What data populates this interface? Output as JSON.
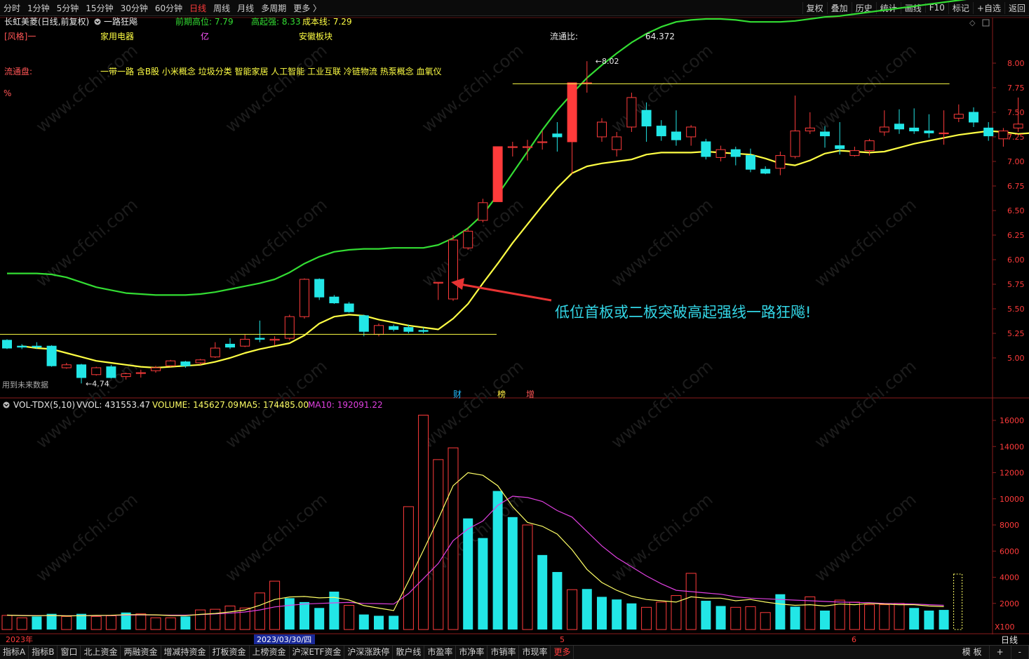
{
  "toolbar": {
    "periods": [
      "分时",
      "1分钟",
      "5分钟",
      "15分钟",
      "30分钟",
      "60分钟",
      "日线",
      "周线",
      "月线",
      "多周期",
      "更多 〉"
    ],
    "active_period": "日线",
    "right_buttons": [
      "复权",
      "叠加",
      "历史",
      "统计",
      "画线",
      "F10",
      "标记",
      "+自选",
      "返回"
    ]
  },
  "header": {
    "stock": "长虹美菱(日线,前复权)",
    "formula": "一路狂飚",
    "labels": [
      {
        "text": "前期高位: 7.79",
        "color": "#33dd33"
      },
      {
        "text": "高起强: 8.33",
        "color": "#33dd33"
      },
      {
        "text": "成本线: 7.29",
        "color": "#ffff44"
      }
    ],
    "style_tag": "[风格]一",
    "industry": "家用电器",
    "yi": "亿",
    "region": "安徽板块",
    "float_label": "流通比:",
    "float_value": "64.372",
    "liutong": "流通盘:",
    "pct": "%",
    "concepts": "一带一路 含B股 小米概念 垃圾分类 智能家居 人工智能 工业互联 冷链物流 热泵概念 血氧仪",
    "future_note": "用到未来数据"
  },
  "annotation": {
    "text": "低位首板或二板突破高起强线一路狂飚!",
    "color": "#33d6e6"
  },
  "markers": [
    "财",
    "榜",
    "增"
  ],
  "vol_header": {
    "name": "VOL-TDX(5,10)",
    "vvol": "VVOL: 431553.47",
    "volume": "VOLUME: 145627.09",
    "ma5": "MA5: 174485.00",
    "ma10": "MA10: 192091.22"
  },
  "date_axis": {
    "year": "2023年",
    "highlight": "2023/03/30/四",
    "m5": "5",
    "m6": "6",
    "right": "日线"
  },
  "vol_unit": "X100",
  "bottom_tabs": [
    "指标A",
    "指标B",
    "窗口",
    "北上资金",
    "两融资金",
    "增减持资金",
    "打板资金",
    "上榜资金",
    "沪深ETF资金",
    "沪深涨跌停",
    "散户线",
    "市盈率",
    "市净率",
    "市销率",
    "市现率",
    "更多"
  ],
  "bottom_right": [
    "模 板",
    "+",
    "-"
  ],
  "colors": {
    "up": "#ff3b3b",
    "down": "#22e6e6",
    "high_line": "#33dd33",
    "cost_line": "#ffff44",
    "ma5": "#ffff66",
    "ma10": "#e040e0"
  },
  "chart_data": [
    {
      "type": "candlestick",
      "title": "长虹美菱(日线,前复权)",
      "ylim": [
        4.6,
        8.3
      ],
      "y_ticks": [
        5.0,
        5.25,
        5.5,
        5.75,
        6.0,
        6.25,
        6.5,
        6.75,
        7.0,
        7.25,
        7.5,
        7.75,
        8.0
      ],
      "annotations": [
        {
          "label": "8.02",
          "value": 8.02
        },
        {
          "label": "4.74",
          "value": 4.74
        }
      ],
      "reference_lines": [
        {
          "value": 7.79
        },
        {
          "value": 5.24
        }
      ],
      "candles": [
        [
          5.18,
          5.1,
          5.19,
          5.09
        ],
        [
          5.12,
          5.11,
          5.14,
          5.09
        ],
        [
          5.12,
          5.11,
          5.16,
          5.09
        ],
        [
          5.12,
          4.92,
          5.13,
          4.91
        ],
        [
          4.9,
          4.93,
          4.95,
          4.89
        ],
        [
          4.93,
          4.8,
          4.94,
          4.74
        ],
        [
          4.83,
          4.9,
          4.91,
          4.82
        ],
        [
          4.91,
          4.8,
          4.93,
          4.79
        ],
        [
          4.81,
          4.84,
          4.85,
          4.78
        ],
        [
          4.85,
          4.85,
          4.88,
          4.8
        ],
        [
          4.87,
          4.9,
          4.92,
          4.85
        ],
        [
          4.92,
          4.97,
          4.98,
          4.91
        ],
        [
          4.96,
          4.92,
          4.97,
          4.9
        ],
        [
          4.95,
          4.98,
          4.99,
          4.93
        ],
        [
          5.01,
          5.1,
          5.16,
          5.0
        ],
        [
          5.14,
          5.11,
          5.2,
          5.09
        ],
        [
          5.12,
          5.19,
          5.24,
          5.11
        ],
        [
          5.2,
          5.19,
          5.38,
          5.16
        ],
        [
          5.18,
          5.19,
          5.22,
          5.13
        ],
        [
          5.2,
          5.42,
          5.44,
          5.18
        ],
        [
          5.42,
          5.8,
          5.81,
          5.4
        ],
        [
          5.8,
          5.62,
          5.81,
          5.59
        ],
        [
          5.62,
          5.56,
          5.64,
          5.55
        ],
        [
          5.55,
          5.47,
          5.57,
          5.46
        ],
        [
          5.43,
          5.27,
          5.44,
          5.22
        ],
        [
          5.24,
          5.33,
          5.35,
          5.22
        ],
        [
          5.32,
          5.29,
          5.34,
          5.27
        ],
        [
          5.31,
          5.27,
          5.34,
          5.25
        ],
        [
          5.28,
          5.27,
          5.31,
          5.25
        ],
        [
          5.77,
          5.77,
          5.77,
          5.59
        ],
        [
          5.6,
          6.2,
          6.25,
          5.58
        ],
        [
          6.12,
          6.29,
          6.33,
          6.1
        ],
        [
          6.4,
          6.58,
          6.62,
          6.38
        ],
        [
          6.59,
          7.15,
          7.15,
          6.59
        ],
        [
          7.15,
          7.15,
          7.2,
          7.05
        ],
        [
          7.15,
          7.15,
          7.22,
          7.01
        ],
        [
          7.2,
          7.2,
          7.31,
          7.12
        ],
        [
          7.28,
          7.25,
          7.4,
          7.1
        ],
        [
          7.2,
          7.8,
          7.8,
          6.87
        ],
        [
          7.8,
          7.8,
          8.02,
          7.7
        ],
        [
          7.25,
          7.4,
          7.44,
          7.2
        ],
        [
          7.12,
          7.25,
          7.3,
          7.05
        ],
        [
          7.35,
          7.65,
          7.7,
          7.3
        ],
        [
          7.52,
          7.36,
          7.6,
          7.2
        ],
        [
          7.36,
          7.26,
          7.42,
          7.21
        ],
        [
          7.3,
          7.22,
          7.52,
          7.16
        ],
        [
          7.25,
          7.35,
          7.37,
          7.16
        ],
        [
          7.2,
          7.05,
          7.23,
          7.02
        ],
        [
          7.04,
          7.12,
          7.16,
          7.0
        ],
        [
          7.12,
          7.05,
          7.15,
          6.96
        ],
        [
          7.06,
          6.92,
          7.13,
          6.89
        ],
        [
          6.92,
          6.88,
          6.95,
          6.87
        ],
        [
          6.93,
          7.06,
          7.1,
          6.86
        ],
        [
          7.05,
          7.31,
          7.67,
          7.03
        ],
        [
          7.31,
          7.34,
          7.5,
          7.28
        ],
        [
          7.3,
          7.26,
          7.36,
          7.14
        ],
        [
          7.16,
          7.13,
          7.4,
          7.07
        ],
        [
          7.06,
          7.11,
          7.15,
          7.05
        ],
        [
          7.11,
          7.21,
          7.23,
          7.06
        ],
        [
          7.3,
          7.35,
          7.52,
          7.26
        ],
        [
          7.38,
          7.33,
          7.53,
          7.28
        ],
        [
          7.34,
          7.31,
          7.54,
          7.28
        ],
        [
          7.31,
          7.29,
          7.48,
          7.24
        ],
        [
          7.29,
          7.29,
          7.52,
          7.17
        ],
        [
          7.44,
          7.48,
          7.58,
          7.4
        ],
        [
          7.5,
          7.4,
          7.55,
          7.35
        ],
        [
          7.34,
          7.26,
          7.4,
          7.21
        ],
        [
          7.23,
          7.31,
          7.34,
          7.15
        ],
        [
          7.34,
          7.38,
          7.65,
          7.3
        ]
      ]
    },
    {
      "type": "bar",
      "title": "VOL-TDX(5,10)",
      "ylim": [
        0,
        17000
      ],
      "y_ticks": [
        2000,
        4000,
        6000,
        8000,
        10000,
        12000,
        14000,
        16000
      ],
      "values": [
        1080,
        900,
        1000,
        1200,
        1000,
        1200,
        1000,
        1050,
        1300,
        1200,
        900,
        900,
        1000,
        1500,
        1550,
        1800,
        1650,
        2800,
        3700,
        2400,
        2100,
        1650,
        2900,
        1850,
        1150,
        1050,
        1050,
        9400,
        16400,
        13000,
        13900,
        8500,
        7000,
        10600,
        8600,
        8000,
        5700,
        4400,
        3050,
        3100,
        2500,
        2300,
        2000,
        1700,
        2100,
        2600,
        4300,
        2200,
        1800,
        1700,
        1750,
        1300,
        2700,
        1750,
        2500,
        1450,
        2250,
        2100,
        1900,
        1900,
        2000,
        1650,
        1450,
        1500
      ],
      "up": [
        true,
        true,
        false,
        false,
        true,
        false,
        true,
        true,
        false,
        true,
        true,
        true,
        false,
        true,
        true,
        true,
        true,
        true,
        true,
        false,
        false,
        false,
        false,
        true,
        false,
        false,
        false,
        true,
        true,
        true,
        true,
        false,
        false,
        false,
        false,
        true,
        false,
        false,
        true,
        false,
        false,
        false,
        false,
        true,
        true,
        true,
        true,
        false,
        false,
        true,
        true,
        true,
        false,
        false,
        true,
        false,
        true,
        true,
        true,
        true,
        true,
        false,
        false,
        false
      ],
      "ma5": [
        1100,
        1070,
        1060,
        1080,
        1040,
        1060,
        1080,
        1090,
        1140,
        1140,
        1120,
        1070,
        1060,
        1160,
        1230,
        1350,
        1500,
        1860,
        2300,
        2490,
        2530,
        2420,
        2460,
        2260,
        1830,
        1640,
        1450,
        3700,
        6050,
        8450,
        11000,
        12000,
        11800,
        11000,
        9400,
        8200,
        7900,
        7300,
        6100,
        4600,
        3600,
        3000,
        2550,
        2300,
        2200,
        2100,
        2500,
        2400,
        2400,
        2200,
        2300,
        2100,
        1950,
        1850,
        1900,
        1800,
        1950,
        1900,
        2000,
        1950,
        1900,
        1900,
        1800,
        1750
      ],
      "ma10": [
        1100,
        1080,
        1070,
        1070,
        1050,
        1060,
        1060,
        1080,
        1100,
        1110,
        1110,
        1100,
        1100,
        1140,
        1190,
        1250,
        1340,
        1500,
        1730,
        1850,
        1950,
        2000,
        2040,
        2070,
        2000,
        1980,
        1950,
        2750,
        3900,
        5050,
        6800,
        7700,
        8300,
        9500,
        10200,
        10100,
        9800,
        9100,
        8600,
        7500,
        6400,
        5500,
        4800,
        4100,
        3500,
        3000,
        2900,
        2800,
        2700,
        2500,
        2400,
        2350,
        2300,
        2250,
        2200,
        2150,
        2100,
        2080,
        2050,
        2000,
        1980,
        1950,
        1900,
        1850
      ],
      "unit": "X100"
    }
  ],
  "overlays": {
    "high_line": [
      5.86,
      5.86,
      5.86,
      5.85,
      5.82,
      5.77,
      5.72,
      5.69,
      5.66,
      5.65,
      5.64,
      5.64,
      5.64,
      5.65,
      5.67,
      5.7,
      5.73,
      5.76,
      5.8,
      5.87,
      5.96,
      6.03,
      6.08,
      6.1,
      6.11,
      6.11,
      6.12,
      6.12,
      6.12,
      6.15,
      6.22,
      6.32,
      6.46,
      6.66,
      6.88,
      7.1,
      7.32,
      7.52,
      7.69,
      7.85,
      7.98,
      8.1,
      8.21,
      8.3,
      8.37,
      8.42,
      8.44,
      8.45,
      8.45,
      8.44,
      8.42,
      8.42,
      8.42,
      8.43,
      8.45,
      8.47,
      8.48,
      8.5,
      8.52,
      8.54,
      8.56,
      8.58,
      8.6,
      8.62,
      8.64,
      8.66,
      8.67,
      8.67,
      8.67
    ],
    "cost_line": [
      5.12,
      5.1,
      5.09,
      5.05,
      5.01,
      4.97,
      4.95,
      4.93,
      4.91,
      4.9,
      4.91,
      4.92,
      4.93,
      4.96,
      5.0,
      5.05,
      5.09,
      5.12,
      5.15,
      5.23,
      5.35,
      5.42,
      5.44,
      5.43,
      5.39,
      5.36,
      5.33,
      5.31,
      5.29,
      5.4,
      5.55,
      5.76,
      5.96,
      6.17,
      6.36,
      6.55,
      6.73,
      6.88,
      6.95,
      6.98,
      7.0,
      7.02,
      7.07,
      7.09,
      7.09,
      7.09,
      7.1,
      7.09,
      7.08,
      7.07,
      7.03,
      6.98,
      6.96,
      7.01,
      7.08,
      7.11,
      7.1,
      7.09,
      7.1,
      7.14,
      7.18,
      7.21,
      7.24,
      7.27,
      7.29,
      7.31,
      7.3,
      7.28,
      7.29
    ],
    "cost_line_start": 1
  }
}
